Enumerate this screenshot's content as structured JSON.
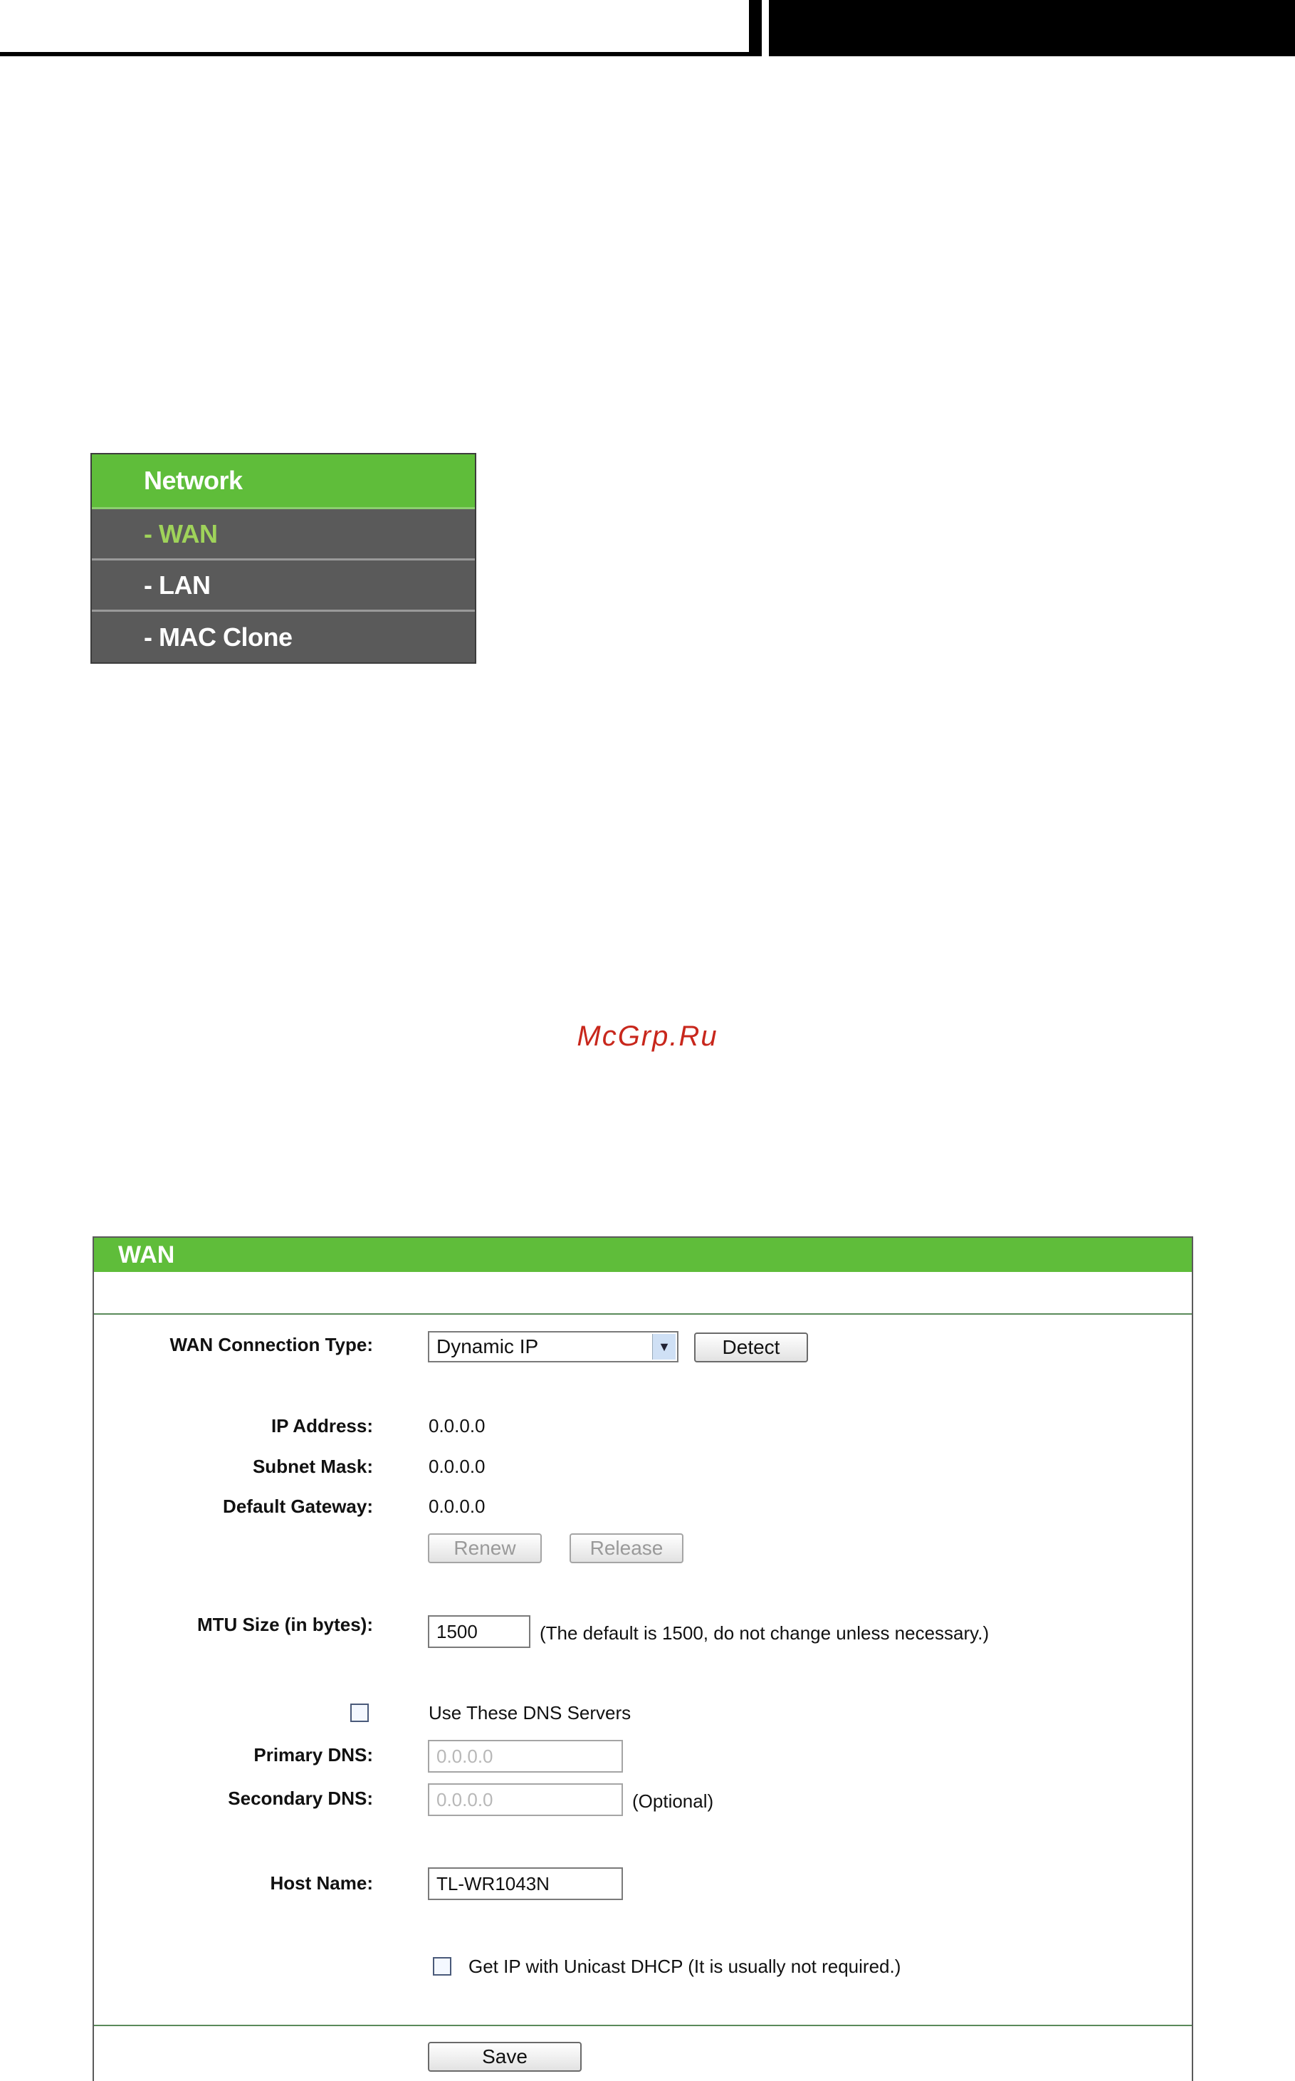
{
  "menu": {
    "header": "Network",
    "items": [
      {
        "label": "- WAN",
        "active": true
      },
      {
        "label": "- LAN",
        "active": false
      },
      {
        "label": "- MAC Clone",
        "active": false
      }
    ]
  },
  "watermark": "McGrp.Ru",
  "wan": {
    "title": "WAN",
    "connection_type_label": "WAN Connection Type:",
    "connection_type_value": "Dynamic IP",
    "detect_label": "Detect",
    "ip_label": "IP Address:",
    "ip_value": "0.0.0.0",
    "mask_label": "Subnet Mask:",
    "mask_value": "0.0.0.0",
    "gateway_label": "Default Gateway:",
    "gateway_value": "0.0.0.0",
    "renew_label": "Renew",
    "release_label": "Release",
    "mtu_label": "MTU Size (in bytes):",
    "mtu_value": "1500",
    "mtu_note": "(The default is 1500, do not change unless necessary.)",
    "use_dns_label": "Use These DNS Servers",
    "primary_dns_label": "Primary DNS:",
    "primary_dns_value": "0.0.0.0",
    "secondary_dns_label": "Secondary DNS:",
    "secondary_dns_value": "0.0.0.0",
    "optional_label": "(Optional)",
    "host_label": "Host Name:",
    "host_value": "TL-WR1043N",
    "unicast_label": "Get IP with Unicast DHCP (It is usually not required.)",
    "save_label": "Save"
  },
  "colors": {
    "accent": "#5fbd3a",
    "menu_bg": "#5a5a5a",
    "menu_active": "#9fd35a",
    "watermark": "#c8271c"
  }
}
